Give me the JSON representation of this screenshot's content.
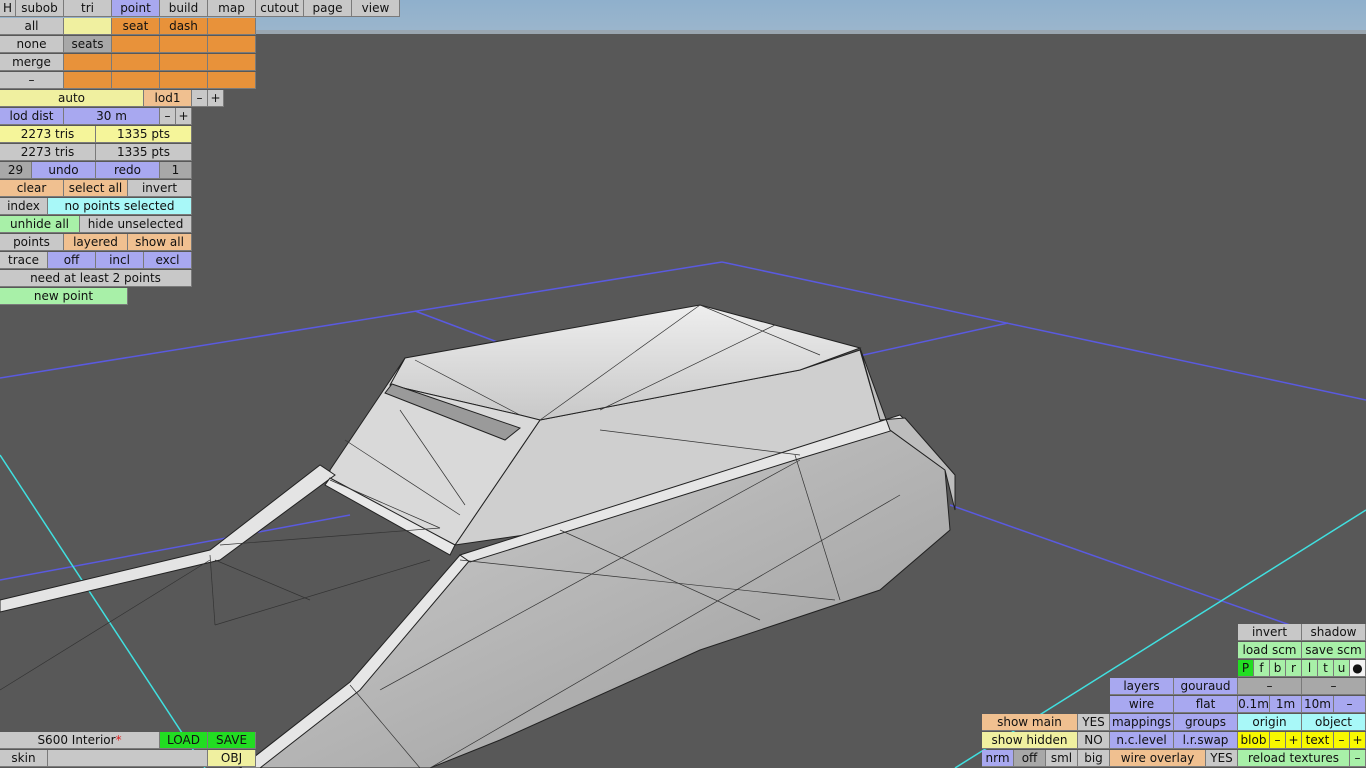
{
  "tabs": {
    "h": "H",
    "subob": "subob",
    "tri": "tri",
    "point": "point",
    "build": "build",
    "map": "map",
    "cutout": "cutout",
    "page": "page",
    "view": "view"
  },
  "grid": {
    "all": "all",
    "none": "none",
    "merge": "merge",
    "dash_row": "–",
    "seat": "seat",
    "dash": "dash",
    "seats": "seats"
  },
  "lod": {
    "auto": "auto",
    "lod1": "lod1",
    "minus": "–",
    "plus": "+",
    "dist_label": "lod dist",
    "dist_value": "30 m"
  },
  "stats": {
    "tris1": "2273 tris",
    "pts1": "1335 pts",
    "tris2": "2273 tris",
    "pts2": "1335 pts"
  },
  "history": {
    "count": "29",
    "undo": "undo",
    "redo": "redo",
    "redo_count": "1"
  },
  "selection": {
    "clear": "clear",
    "select_all": "select all",
    "invert": "invert",
    "index": "index",
    "status": "no points selected",
    "unhide_all": "unhide all",
    "hide_unselected": "hide unselected",
    "points": "points",
    "layered": "layered",
    "show_all": "show all",
    "trace": "trace",
    "off": "off",
    "incl": "incl",
    "excl": "excl",
    "need_points": "need at least 2 points",
    "new_point": "new point"
  },
  "file": {
    "name": "S600 Interior",
    "modified_mark": "*",
    "load": "LOAD",
    "save": "SAVE",
    "skin": "skin",
    "obj": "OBJ"
  },
  "right_panel": {
    "invert": "invert",
    "shadow": "shadow",
    "load_scm": "load scm",
    "save_scm": "save scm",
    "view_letters": [
      "P",
      "f",
      "b",
      "r",
      "l",
      "t",
      "u"
    ],
    "dot": "●",
    "layers": "layers",
    "gouraud": "gouraud",
    "dash": "–",
    "wire": "wire",
    "flat": "flat",
    "m01": "0.1m",
    "m1": "1m",
    "m10": "10m",
    "mappings": "mappings",
    "groups": "groups",
    "origin": "origin",
    "object": "object",
    "nclevel": "n.c.level",
    "lrswap": "l.r.swap",
    "blob": "blob",
    "text": "text",
    "plus": "+",
    "show_main": "show main",
    "yes": "YES",
    "show_hidden": "show hidden",
    "no": "NO",
    "nrm": "nrm",
    "off": "off",
    "sml": "sml",
    "big": "big",
    "wire_overlay": "wire overlay",
    "yes2": "YES",
    "reload_textures": "reload textures"
  }
}
